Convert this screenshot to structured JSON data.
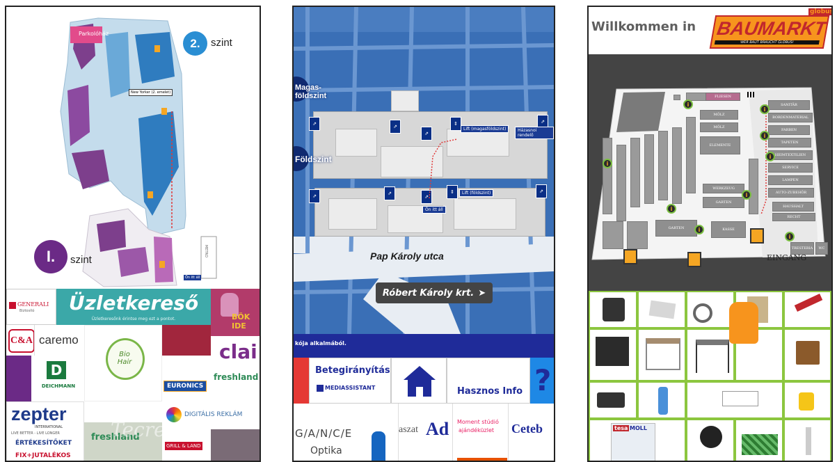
{
  "panel1": {
    "map": {
      "level2_number": "2.",
      "level2_word": "szint",
      "level1_number": "I.",
      "level1_word": "szint",
      "parking_label": "Parkolóház",
      "you_are_here_label": "New Yorker (2. emelet)",
      "lift_label": "LIFT",
      "stand_label": "Ön itt áll",
      "metro_label": "METRO"
    },
    "tiles": {
      "generali": "GENERALI",
      "generali_sub": "Biztosító",
      "finder_title": "Üzletkereső",
      "finder_sub": "Üzletkeresőnk érintse meg ezt a pontot.",
      "boki_text": "BÖK IDE",
      "ca": "C&A",
      "caremo": "caremo",
      "bio_text": "Bio Hair",
      "claire": "clai",
      "deichmann_logo": "D",
      "deichmann": "DEICHMANN",
      "freshland": "freshland",
      "euronics": "EURONICS",
      "zepter": "zepter",
      "zepter_sub": "INTERNATIONAL",
      "zepter_tag": "LIVE BETTER - LIVE LONGER",
      "zepter_offer": "ÉRTÉKESÍTŐKET",
      "zepter_offer2": "FIX+JUTALÉKOS",
      "digital": "DIGITÁLIS REKLÁM",
      "freshland2": "freshland",
      "gift": "GRILL & LAND",
      "watermark": "Tecreant"
    }
  },
  "panel2": {
    "map": {
      "badge_upper": "Magas-földszint",
      "badge_lower": "Földszint",
      "lift_upper": "Lift (magasföldszint)",
      "rest_upper": "Házasnoi rendelő",
      "lift_lower": "Lift (földszint)",
      "stand_here": "Ön itt áll",
      "street": "Pap Károly utca",
      "boulevard": "Róbert Károly krt."
    },
    "tiles": {
      "ticker": "kója alkalmából.",
      "guide": "Betegirányítás",
      "mediassistant": "MEDIASSISTANT",
      "useful": "Hasznos Info",
      "help": "?",
      "optic_brand": "G/A/N/C/E",
      "optic": "Optika",
      "hair": "aszat",
      "ad": "Ad",
      "moment1": "Moment stúdió",
      "moment2": "ajándéküzlet",
      "ceteb": "Ceteb"
    }
  },
  "panel3": {
    "welcome": "Willkommen in",
    "brand": "BAUMARKT",
    "slogan": "WER BAUT BRAUCHT GLOBUS!",
    "globus": "globus",
    "entrance": "EINGANG",
    "depts": [
      "FLIESEN",
      "MÖLZ",
      "MÖLZ",
      "SANITÄR",
      "BORDENMATERIAL",
      "FARBEN",
      "TAPETEN",
      "HEIMTEXTILIEN",
      "ELEMENTE",
      "SERVICE",
      "LAMPEN",
      "AUTO-ZUBEHÖR",
      "WERKZEUG",
      "GARTEN",
      "HAUSHALT",
      "RECHT",
      "GARTEN",
      "KASSE",
      "TRESTERIA",
      "WC"
    ],
    "products": [
      "grill",
      "ceiling-lamp",
      "light-strip",
      "wood-pellets",
      "sander",
      "garden-shed",
      "gazebo",
      "table-saw",
      "paint-bucket",
      "tool-case",
      "fire-extinguisher",
      "laundry-rack",
      "vacuum",
      "tesa-moll",
      "plant-pot",
      "grass-paver",
      "bed",
      "cartridge",
      "fitting"
    ],
    "tesa": "tesa",
    "moll": "MOLL"
  }
}
